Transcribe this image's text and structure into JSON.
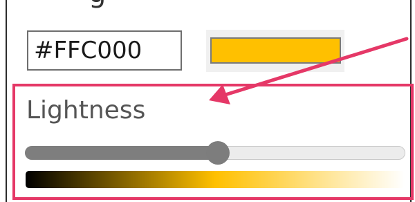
{
  "color_picker": {
    "hex_value": "#FFC000",
    "swatch_color": "#FFC000",
    "lightness": {
      "label": "Lightness",
      "value_fraction": 0.507,
      "gradient_start": "#000000",
      "gradient_mid": "#FFC000",
      "gradient_end": "#FFFFFF"
    }
  },
  "annotation": {
    "highlight_color": "#E53867"
  }
}
